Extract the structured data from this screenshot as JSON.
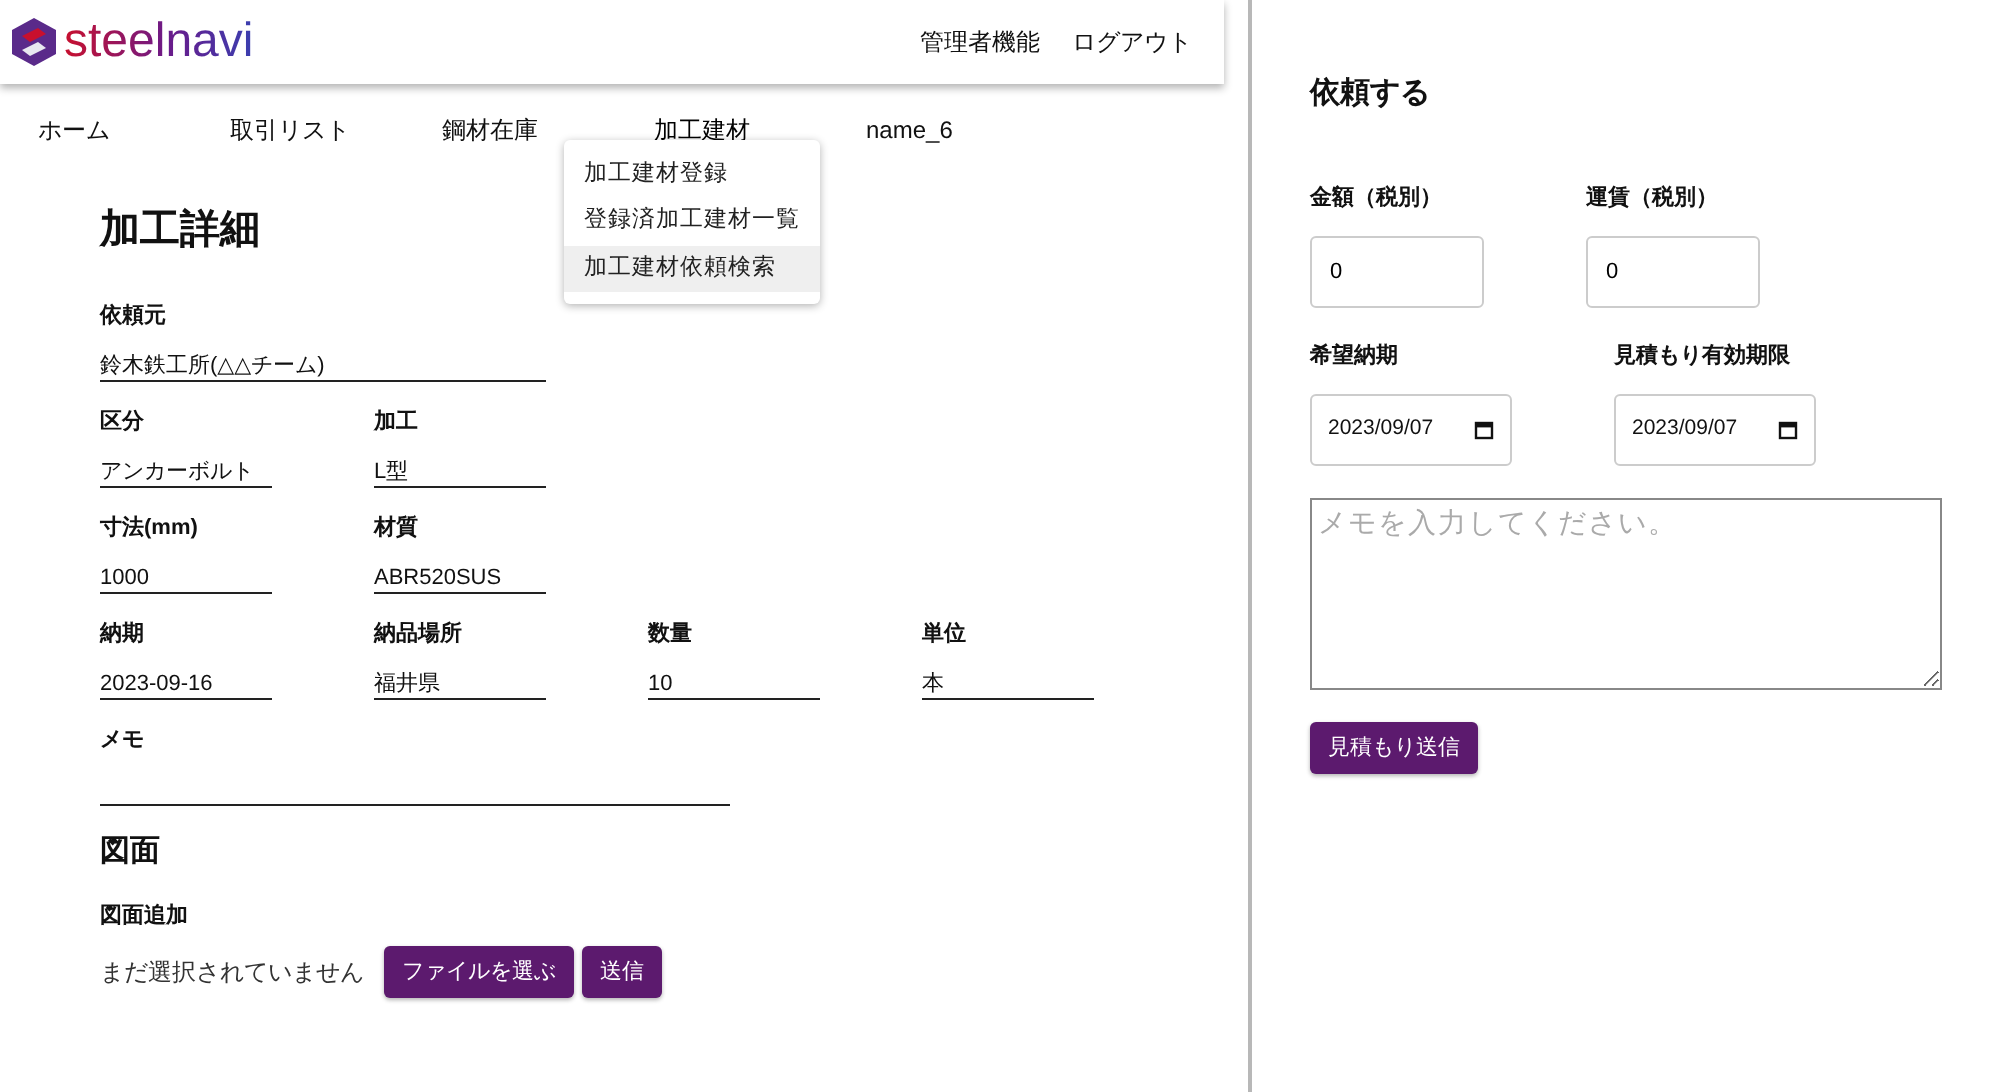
{
  "header": {
    "logo_text": "steelnavi",
    "links": [
      "管理者機能",
      "ログアウト"
    ]
  },
  "tabs": [
    {
      "label": "ホーム",
      "expanded": false
    },
    {
      "label": "取引リスト",
      "expanded": false
    },
    {
      "label": "鋼材在庫",
      "expanded": false
    },
    {
      "label": "加工建材",
      "expanded": true,
      "menu": [
        {
          "label": "加工建材登録",
          "selected": false
        },
        {
          "label": "登録済加工建材一覧",
          "selected": false
        },
        {
          "label": "加工建材依頼検索",
          "selected": true
        }
      ]
    },
    {
      "label": "name_6",
      "expanded": false
    }
  ],
  "detail": {
    "title": "加工詳細",
    "rows": [
      [
        {
          "label": "依頼元",
          "value": "鈴木鉄工所(△△チーム)",
          "kind": "wide"
        }
      ],
      [
        {
          "label": "区分",
          "value": "アンカーボルト",
          "kind": "short"
        },
        {
          "label": "加工",
          "value": "L型",
          "kind": "short"
        }
      ],
      [
        {
          "label": "寸法(mm)",
          "value": "1000",
          "kind": "short"
        },
        {
          "label": "材質",
          "value": "ABR520SUS",
          "kind": "short"
        }
      ],
      [
        {
          "label": "納期",
          "value": "2023-09-16",
          "kind": "short"
        },
        {
          "label": "納品場所",
          "value": "福井県",
          "kind": "short"
        },
        {
          "label": "数量",
          "value": "10",
          "kind": "short"
        },
        {
          "label": "単位",
          "value": "本",
          "kind": "short"
        }
      ],
      [
        {
          "label": "メモ",
          "kind": "long"
        }
      ]
    ]
  },
  "drawing": {
    "title": "図面",
    "label": "図面追加",
    "file_status": "まだ選択されていません",
    "buttons": [
      "ファイルを選ぶ",
      "送信"
    ]
  },
  "request": {
    "title": "依頼する",
    "rows": [
      [
        {
          "label": "金額（税別）",
          "value": "0",
          "kind": "number"
        },
        {
          "label": "運賃（税別）",
          "value": "0",
          "kind": "number"
        }
      ],
      [
        {
          "label": "希望納期",
          "value": "2023/09/07",
          "kind": "date"
        },
        {
          "label": "見積もり有効期限",
          "value": "2023/09/07",
          "kind": "date"
        }
      ]
    ],
    "memo_placeholder": "メモを入力してください。",
    "submit": "見積もり送信"
  }
}
